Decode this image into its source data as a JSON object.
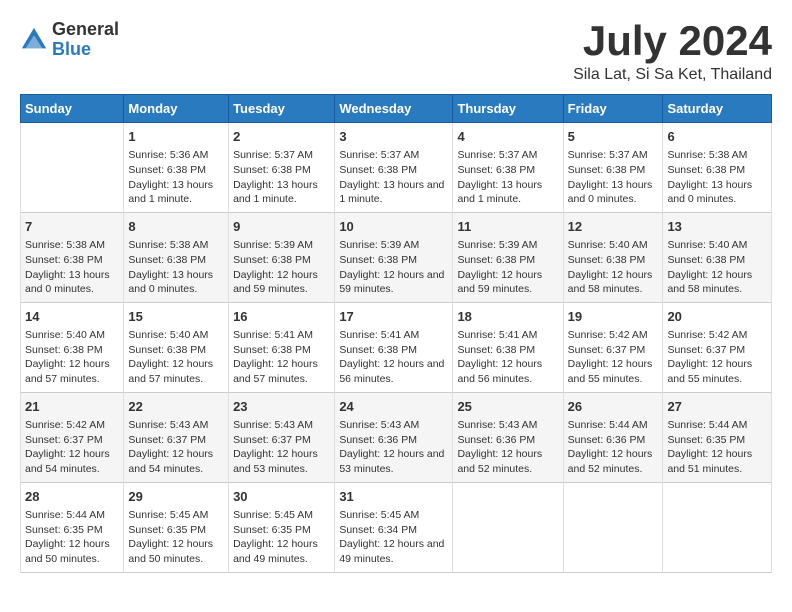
{
  "logo": {
    "general": "General",
    "blue": "Blue"
  },
  "title": "July 2024",
  "subtitle": "Sila Lat, Si Sa Ket, Thailand",
  "calendar": {
    "headers": [
      "Sunday",
      "Monday",
      "Tuesday",
      "Wednesday",
      "Thursday",
      "Friday",
      "Saturday"
    ],
    "weeks": [
      [
        {
          "day": "",
          "info": ""
        },
        {
          "day": "1",
          "info": "Sunrise: 5:36 AM\nSunset: 6:38 PM\nDaylight: 13 hours and 1 minute."
        },
        {
          "day": "2",
          "info": "Sunrise: 5:37 AM\nSunset: 6:38 PM\nDaylight: 13 hours and 1 minute."
        },
        {
          "day": "3",
          "info": "Sunrise: 5:37 AM\nSunset: 6:38 PM\nDaylight: 13 hours and 1 minute."
        },
        {
          "day": "4",
          "info": "Sunrise: 5:37 AM\nSunset: 6:38 PM\nDaylight: 13 hours and 1 minute."
        },
        {
          "day": "5",
          "info": "Sunrise: 5:37 AM\nSunset: 6:38 PM\nDaylight: 13 hours and 0 minutes."
        },
        {
          "day": "6",
          "info": "Sunrise: 5:38 AM\nSunset: 6:38 PM\nDaylight: 13 hours and 0 minutes."
        }
      ],
      [
        {
          "day": "7",
          "info": "Sunrise: 5:38 AM\nSunset: 6:38 PM\nDaylight: 13 hours and 0 minutes."
        },
        {
          "day": "8",
          "info": "Sunrise: 5:38 AM\nSunset: 6:38 PM\nDaylight: 13 hours and 0 minutes."
        },
        {
          "day": "9",
          "info": "Sunrise: 5:39 AM\nSunset: 6:38 PM\nDaylight: 12 hours and 59 minutes."
        },
        {
          "day": "10",
          "info": "Sunrise: 5:39 AM\nSunset: 6:38 PM\nDaylight: 12 hours and 59 minutes."
        },
        {
          "day": "11",
          "info": "Sunrise: 5:39 AM\nSunset: 6:38 PM\nDaylight: 12 hours and 59 minutes."
        },
        {
          "day": "12",
          "info": "Sunrise: 5:40 AM\nSunset: 6:38 PM\nDaylight: 12 hours and 58 minutes."
        },
        {
          "day": "13",
          "info": "Sunrise: 5:40 AM\nSunset: 6:38 PM\nDaylight: 12 hours and 58 minutes."
        }
      ],
      [
        {
          "day": "14",
          "info": "Sunrise: 5:40 AM\nSunset: 6:38 PM\nDaylight: 12 hours and 57 minutes."
        },
        {
          "day": "15",
          "info": "Sunrise: 5:40 AM\nSunset: 6:38 PM\nDaylight: 12 hours and 57 minutes."
        },
        {
          "day": "16",
          "info": "Sunrise: 5:41 AM\nSunset: 6:38 PM\nDaylight: 12 hours and 57 minutes."
        },
        {
          "day": "17",
          "info": "Sunrise: 5:41 AM\nSunset: 6:38 PM\nDaylight: 12 hours and 56 minutes."
        },
        {
          "day": "18",
          "info": "Sunrise: 5:41 AM\nSunset: 6:38 PM\nDaylight: 12 hours and 56 minutes."
        },
        {
          "day": "19",
          "info": "Sunrise: 5:42 AM\nSunset: 6:37 PM\nDaylight: 12 hours and 55 minutes."
        },
        {
          "day": "20",
          "info": "Sunrise: 5:42 AM\nSunset: 6:37 PM\nDaylight: 12 hours and 55 minutes."
        }
      ],
      [
        {
          "day": "21",
          "info": "Sunrise: 5:42 AM\nSunset: 6:37 PM\nDaylight: 12 hours and 54 minutes."
        },
        {
          "day": "22",
          "info": "Sunrise: 5:43 AM\nSunset: 6:37 PM\nDaylight: 12 hours and 54 minutes."
        },
        {
          "day": "23",
          "info": "Sunrise: 5:43 AM\nSunset: 6:37 PM\nDaylight: 12 hours and 53 minutes."
        },
        {
          "day": "24",
          "info": "Sunrise: 5:43 AM\nSunset: 6:36 PM\nDaylight: 12 hours and 53 minutes."
        },
        {
          "day": "25",
          "info": "Sunrise: 5:43 AM\nSunset: 6:36 PM\nDaylight: 12 hours and 52 minutes."
        },
        {
          "day": "26",
          "info": "Sunrise: 5:44 AM\nSunset: 6:36 PM\nDaylight: 12 hours and 52 minutes."
        },
        {
          "day": "27",
          "info": "Sunrise: 5:44 AM\nSunset: 6:35 PM\nDaylight: 12 hours and 51 minutes."
        }
      ],
      [
        {
          "day": "28",
          "info": "Sunrise: 5:44 AM\nSunset: 6:35 PM\nDaylight: 12 hours and 50 minutes."
        },
        {
          "day": "29",
          "info": "Sunrise: 5:45 AM\nSunset: 6:35 PM\nDaylight: 12 hours and 50 minutes."
        },
        {
          "day": "30",
          "info": "Sunrise: 5:45 AM\nSunset: 6:35 PM\nDaylight: 12 hours and 49 minutes."
        },
        {
          "day": "31",
          "info": "Sunrise: 5:45 AM\nSunset: 6:34 PM\nDaylight: 12 hours and 49 minutes."
        },
        {
          "day": "",
          "info": ""
        },
        {
          "day": "",
          "info": ""
        },
        {
          "day": "",
          "info": ""
        }
      ]
    ]
  }
}
